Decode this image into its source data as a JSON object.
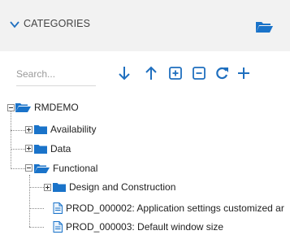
{
  "header": {
    "title": "CATEGORIES"
  },
  "search": {
    "placeholder": "Search..."
  },
  "toolbar": {
    "icons": [
      "arrow-down-icon",
      "arrow-up-icon",
      "expand-all-icon",
      "collapse-all-icon",
      "refresh-icon",
      "add-icon"
    ]
  },
  "tree": {
    "root": {
      "label": "RMDEMO",
      "expanded": true
    },
    "children": [
      {
        "label": "Availability",
        "expanded": false
      },
      {
        "label": "Data",
        "expanded": false
      },
      {
        "label": "Functional",
        "expanded": true,
        "children": [
          {
            "label": "Design and Construction",
            "expanded": false
          },
          {
            "label": "PROD_000002: Application settings customized ar"
          },
          {
            "label": "PROD_000003: Default window size"
          }
        ]
      }
    ]
  },
  "colors": {
    "accent": "#1f6fbf",
    "folder": "#1a73c9",
    "header_bg": "#f2f2f2"
  }
}
